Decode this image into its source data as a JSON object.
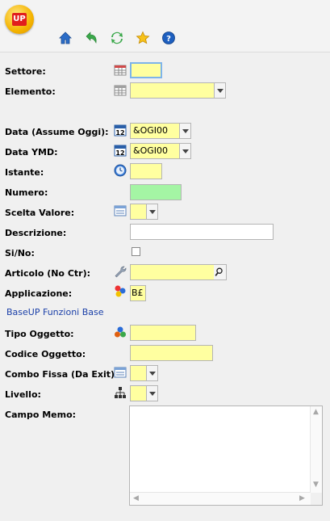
{
  "app": {
    "logo_text": "UP"
  },
  "toolbar": [
    {
      "name": "home-icon"
    },
    {
      "name": "back-icon"
    },
    {
      "name": "refresh-icon"
    },
    {
      "name": "favorite-icon"
    },
    {
      "name": "help-icon"
    }
  ],
  "fields": {
    "settore": {
      "label": "Settore:",
      "value": ""
    },
    "elemento": {
      "label": "Elemento:",
      "value": ""
    },
    "data_assume_oggi": {
      "label": "Data (Assume Oggi):",
      "value": "&OGI00"
    },
    "data_ymd": {
      "label": "Data YMD:",
      "value": "&OGI00"
    },
    "istante": {
      "label": "Istante:",
      "value": ""
    },
    "numero": {
      "label": "Numero:",
      "value": ""
    },
    "scelta_valore": {
      "label": "Scelta Valore:",
      "value": ""
    },
    "descrizione": {
      "label": "Descrizione:",
      "value": ""
    },
    "si_no": {
      "label": "Si/No:",
      "checked": false
    },
    "articolo": {
      "label": "Articolo (No Ctr):",
      "value": ""
    },
    "applicazione": {
      "label": "Applicazione:",
      "value": "B£"
    },
    "applicazione_desc": "BaseUP Funzioni Base",
    "tipo_oggetto": {
      "label": "Tipo Oggetto:",
      "value": ""
    },
    "codice_oggetto": {
      "label": "Codice Oggetto:",
      "value": ""
    },
    "combo_fissa": {
      "label": "Combo Fissa (Da Exit):",
      "value": ""
    },
    "livello": {
      "label": "Livello:",
      "value": ""
    },
    "campo_memo": {
      "label": "Campo Memo:",
      "value": ""
    }
  },
  "calendar_icon_text": "12",
  "colors": {
    "field_yellow": "#ffffa0",
    "field_green": "#a4f5a4",
    "link_blue": "#1a3fa8"
  }
}
